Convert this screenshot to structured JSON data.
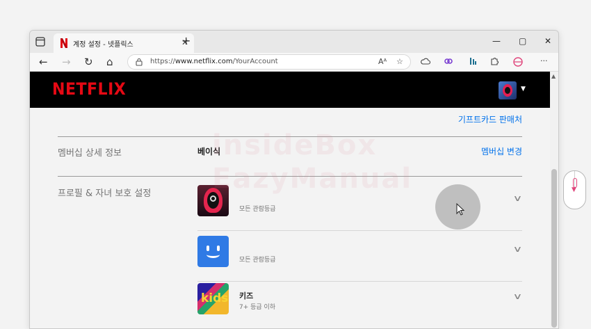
{
  "browser": {
    "tab_title": "계정 설정 - 넷플릭스",
    "tab_close": "✕",
    "new_tab": "+",
    "minimize": "—",
    "maximize": "▢",
    "close": "✕",
    "url_prefix": "https://",
    "url_host": "www.netflix.com",
    "url_path": "/YourAccount",
    "back": "←",
    "forward": "→",
    "refresh": "↻",
    "home": "⌂",
    "more": "···",
    "read_aloud": "Aᴬ",
    "favorite": "☆"
  },
  "netflix": {
    "logo": "NETFLIX",
    "caret": "▼",
    "gift_link": "기프트카드 판매처",
    "membership_label": "멤버십 상세 정보",
    "plan": "베이식",
    "change_plan": "멤버십 변경",
    "profiles_label": "프로필 & 자녀 보호 설정",
    "profiles": [
      {
        "name": "",
        "rating": "모든 관람등급",
        "avatar": "squid"
      },
      {
        "name": "",
        "rating": "모든 관람등급",
        "avatar": "smile"
      },
      {
        "name": "키즈",
        "rating": "7+ 등급 이하",
        "avatar": "kids"
      }
    ],
    "kids_avatar_text": "kids",
    "chevron": "∨"
  },
  "watermark": {
    "line1": "insideBox",
    "line2": "EazyManual"
  },
  "colors": {
    "netflix_red": "#e50914",
    "link_blue": "#0071eb",
    "cursor_halo": "#808080"
  },
  "icons": [
    "sidebar-tabs-icon",
    "netflix-favicon",
    "lock-icon",
    "read-aloud-icon",
    "add-favorite-icon",
    "cloud-icon",
    "extension-icons",
    "settings-more-icon",
    "mouse-scroll-icon",
    "cursor-icon"
  ]
}
